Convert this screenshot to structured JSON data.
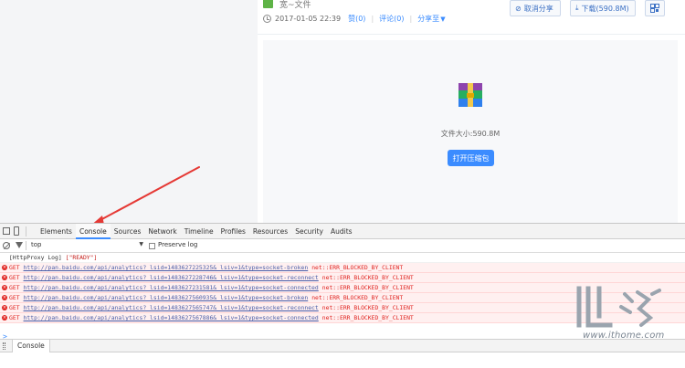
{
  "file": {
    "name": "宽~文件",
    "share_date": "2017-01-05 22:39",
    "links": [
      "赞(0)",
      "评论(0)",
      "分享至"
    ],
    "cancel_share_label": "取消分享",
    "download_label": "下载(590.8M)",
    "size_text": "文件大小:590.8M",
    "open_archive_label": "打开压缩包"
  },
  "devtools": {
    "tabs": [
      "Elements",
      "Console",
      "Sources",
      "Network",
      "Timeline",
      "Profiles",
      "Resources",
      "Security",
      "Audits"
    ],
    "active_tab": "Console",
    "context_value": "top",
    "preserve_log_label": "Preserve log",
    "prompt": ">",
    "drawer_tab": "Console",
    "info_log": {
      "label": "[HttpProxy Log]",
      "value": "[\"READY\"]"
    },
    "error_logs": [
      {
        "method": "GET",
        "url": "http://pan.baidu.com/api/analytics?_lsid=1483627225325&_lsiv=1&type=socket-broken",
        "status": "net::ERR_BLOCKED_BY_CLIENT"
      },
      {
        "method": "GET",
        "url": "http://pan.baidu.com/api/analytics?_lsid=1483627228746&_lsiv=1&type=socket-reconnect",
        "status": "net::ERR_BLOCKED_BY_CLIENT"
      },
      {
        "method": "GET",
        "url": "http://pan.baidu.com/api/analytics?_lsid=1483627231581&_lsiv=1&type=socket-connected",
        "status": "net::ERR_BLOCKED_BY_CLIENT"
      },
      {
        "method": "GET",
        "url": "http://pan.baidu.com/api/analytics?_lsid=1483627560935&_lsiv=1&type=socket-broken",
        "status": "net::ERR_BLOCKED_BY_CLIENT"
      },
      {
        "method": "GET",
        "url": "http://pan.baidu.com/api/analytics?_lsid=1483627565747&_lsiv=1&type=socket-reconnect",
        "status": "net::ERR_BLOCKED_BY_CLIENT"
      },
      {
        "method": "GET",
        "url": "http://pan.baidu.com/api/analytics?_lsid=1483627567886&_lsiv=1&type=socket-connected",
        "status": "net::ERR_BLOCKED_BY_CLIENT"
      }
    ]
  },
  "watermark": {
    "text": "www.ithome.com"
  },
  "icons": {
    "clock": "clock-icon",
    "cancel": "cancel-share-icon",
    "download": "download-icon",
    "qr": "qr-code-icon",
    "archive": "archive-file-icon",
    "inspect": "inspect-element-icon",
    "device": "device-mode-icon",
    "clear": "clear-console-icon",
    "filter": "filter-icon",
    "error": "error-icon",
    "menu": "drawer-menu-icon"
  },
  "colors": {
    "accent": "#3b8cff",
    "error": "#e0231f",
    "error_bg": "#fff0f0",
    "annotation_arrow": "#e53935"
  }
}
